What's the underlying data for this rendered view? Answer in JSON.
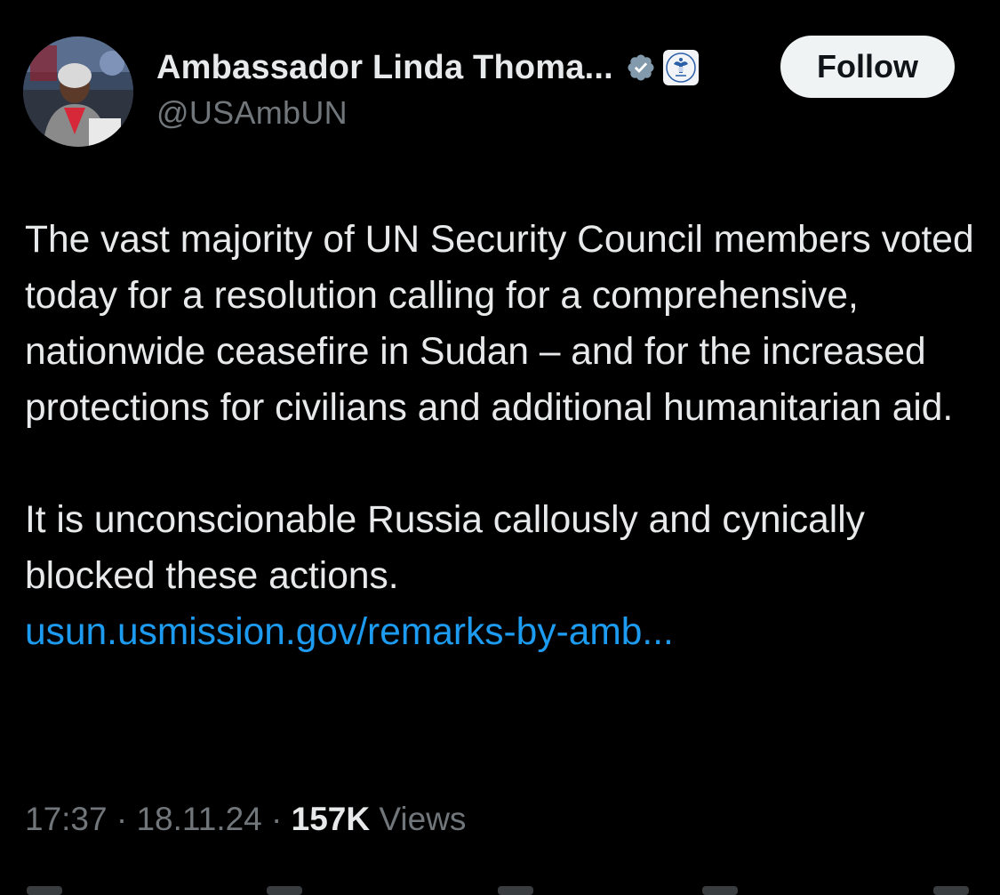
{
  "author": {
    "display_name": "Ambassador Linda Thoma...",
    "handle": "@USAmbUN",
    "verified_icon": "verified-badge-icon",
    "affiliate_icon": "us-seal-icon"
  },
  "follow_button": {
    "label": "Follow"
  },
  "tweet": {
    "paragraph_1": "The vast majority of UN Security Council members voted today for a resolution calling for a comprehensive, nationwide ceasefire in Sudan – and for the increased protections for civilians and additional humanitarian aid.",
    "paragraph_2": "It is unconscionable Russia callously and cynically blocked these actions.",
    "link_text": "usun.usmission.gov/remarks-by-amb..."
  },
  "meta": {
    "time": "17:37",
    "date": "18.11.24",
    "separator": "·",
    "views_count": "157K",
    "views_label": "Views"
  },
  "colors": {
    "background": "#000000",
    "text": "#e7e9ea",
    "secondary": "#71767b",
    "link": "#1d9bf0",
    "follow_bg": "#eff3f4"
  }
}
